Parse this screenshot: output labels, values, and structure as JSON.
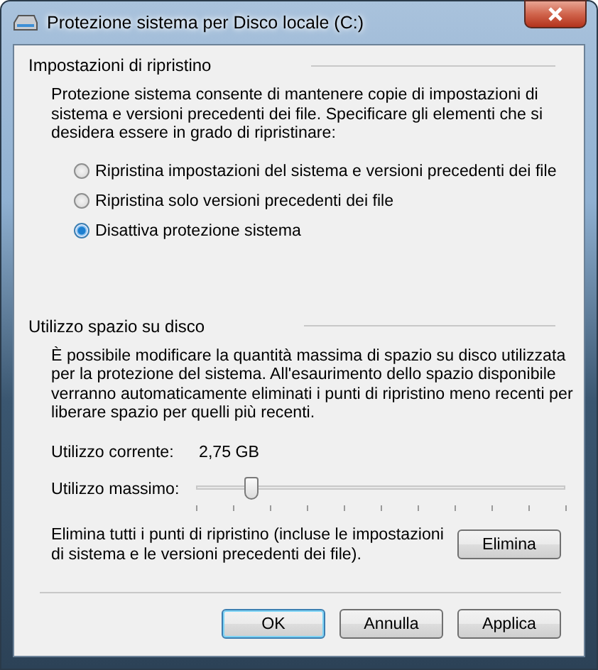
{
  "window": {
    "title": "Protezione sistema per Disco locale (C:)"
  },
  "restore_settings": {
    "title": "Impostazioni di ripristino",
    "description": "Protezione sistema consente di mantenere copie di impostazioni di sistema e versioni precedenti dei file. Specificare gli elementi che si desidera essere in grado di ripristinare:",
    "options": [
      {
        "label": "Ripristina impostazioni del sistema e versioni precedenti dei file",
        "selected": false
      },
      {
        "label": "Ripristina solo versioni precedenti dei file",
        "selected": false
      },
      {
        "label": "Disattiva protezione sistema",
        "selected": true
      }
    ]
  },
  "disk_usage": {
    "title": "Utilizzo spazio su disco",
    "description": "È possibile modificare la quantità massima di spazio su disco utilizzata per la protezione del sistema. All'esaurimento dello spazio disponibile verranno automaticamente eliminati i punti di ripristino meno recenti per liberare spazio per quelli più recenti.",
    "current_usage_label": "Utilizzo corrente:",
    "current_usage_value": "2,75 GB",
    "max_usage_label": "Utilizzo massimo:",
    "max_usage": {
      "level": 0.15
    },
    "delete_text": "Elimina tutti i punti di ripristino (incluse le impostazioni di sistema e le versioni precedenti dei file).",
    "delete_button": "Elimina"
  },
  "buttons": [
    {
      "label": "OK",
      "default": true
    },
    {
      "label": "Annulla",
      "default": false
    },
    {
      "label": "Applica",
      "default": false
    }
  ]
}
